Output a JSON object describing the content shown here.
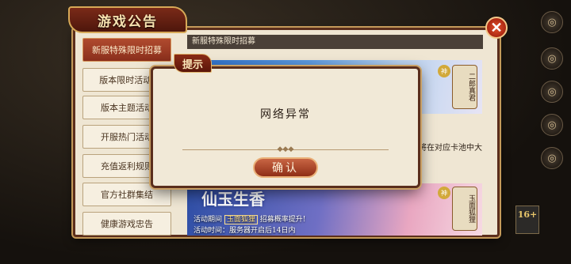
{
  "notice": {
    "title": "游戏公告",
    "close_symbol": "✕",
    "tabs": [
      {
        "label": "新服特殊限时招募",
        "active": true
      },
      {
        "label": "版本限时活动·",
        "active": false
      },
      {
        "label": "版本主题活动",
        "active": false
      },
      {
        "label": "开服热门活动",
        "active": false
      },
      {
        "label": "充值返利规则",
        "active": false
      },
      {
        "label": "官方社群集结",
        "active": false
      },
      {
        "label": "健康游戏忠告",
        "active": false
      }
    ],
    "content_title": "新服特殊限时招募",
    "banner1": {
      "character": "二郎真君",
      "rarity": "神"
    },
    "trailing_text": "将在对应卡池中大",
    "banner2": {
      "title": "仙玉生香",
      "character": "玉面狐狸",
      "rarity": "神",
      "line1_prefix": "活动期间",
      "line1_highlight": "玉面狐狸",
      "line1_suffix": "招募概率提升!",
      "line2": "活动时间：服务器开启后14日内"
    },
    "age_rating": "16+"
  },
  "dialog": {
    "tag": "提示",
    "message": "网络异常",
    "confirm_label": "确认"
  },
  "colors": {
    "panel_border": "#5b2e1c",
    "accent_red": "#8a2f1c",
    "gold": "#d7a957",
    "paper": "#efe6d3"
  }
}
